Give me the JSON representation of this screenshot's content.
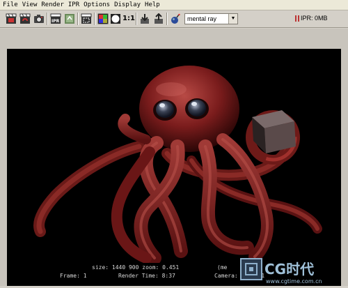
{
  "menu": [
    "File",
    "View",
    "Render",
    "IPR",
    "Options",
    "Display",
    "Help"
  ],
  "toolbar": {
    "ratio_label": "1:1",
    "renderer": "mental ray",
    "ipr_status": "IPR: 0MB",
    "icons": [
      "render-frame-icon",
      "redo-render-icon",
      "snapshot-icon",
      "ipr-render-icon",
      "refresh-ipr-icon",
      "render-region-icon",
      "rgb-channel-icon",
      "alpha-channel-icon",
      "keep-image-icon",
      "remove-image-icon",
      "render-globals-icon"
    ]
  },
  "render_info": {
    "line1": "size: 1440  900 zoom: 0.451",
    "line1_right": "(me",
    "frame": "Frame: 1",
    "render_time": "Render Time:  8:37",
    "camera": "Camera: camera1"
  },
  "watermark": {
    "brand": "CG时代",
    "url": "www.cgtime.com.cn"
  }
}
